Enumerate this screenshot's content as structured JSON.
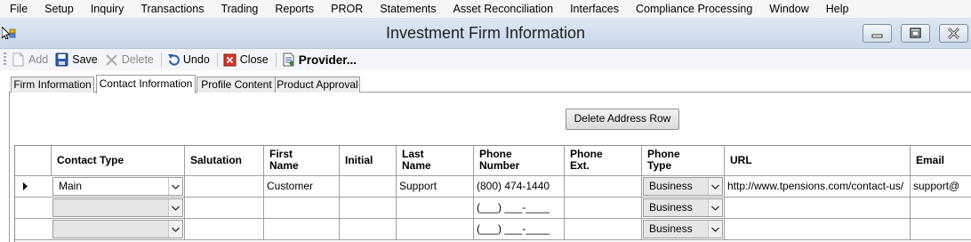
{
  "menu": [
    "File",
    "Setup",
    "Inquiry",
    "Transactions",
    "Trading",
    "Reports",
    "PROR",
    "Statements",
    "Asset Reconciliation",
    "Interfaces",
    "Compliance Processing",
    "Window",
    "Help"
  ],
  "window": {
    "title": "Investment Firm Information"
  },
  "toolbar": {
    "add_label": "Add",
    "save_label": "Save",
    "delete_label": "Delete",
    "undo_label": "Undo",
    "close_label": "Close",
    "provider_label": "Provider..."
  },
  "tabs": [
    "Firm Information",
    "Contact Information",
    "Profile Content",
    "Product Approval"
  ],
  "active_tab": "Contact Information",
  "delete_address_row_label": "Delete Address Row",
  "grid": {
    "headers": {
      "contact_type": "Contact Type",
      "salutation": "Salutation",
      "first_name_1": "First",
      "first_name_2": "Name",
      "initial": "Initial",
      "last_name_1": "Last",
      "last_name_2": "Name",
      "phone_number_1": "Phone",
      "phone_number_2": "Number",
      "phone_ext_1": "Phone",
      "phone_ext_2": "Ext.",
      "phone_type_1": "Phone",
      "phone_type_2": "Type",
      "url": "URL",
      "email": "Email"
    },
    "rows": [
      {
        "contact_type": "Main",
        "salutation": "",
        "first_name": "Customer",
        "initial": "",
        "last_name": "Support",
        "phone_number": "(800) 474-1440",
        "phone_ext": "",
        "phone_type": "Business",
        "url": "http://www.tpensions.com/contact-us/",
        "email": "support@"
      },
      {
        "contact_type": "",
        "salutation": "",
        "first_name": "",
        "initial": "",
        "last_name": "",
        "phone_number": "(___) ___-____",
        "phone_ext": "",
        "phone_type": "Business",
        "url": "",
        "email": ""
      },
      {
        "contact_type": "",
        "salutation": "",
        "first_name": "",
        "initial": "",
        "last_name": "",
        "phone_number": "(___) ___-____",
        "phone_ext": "",
        "phone_type": "Business",
        "url": "",
        "email": ""
      }
    ]
  }
}
